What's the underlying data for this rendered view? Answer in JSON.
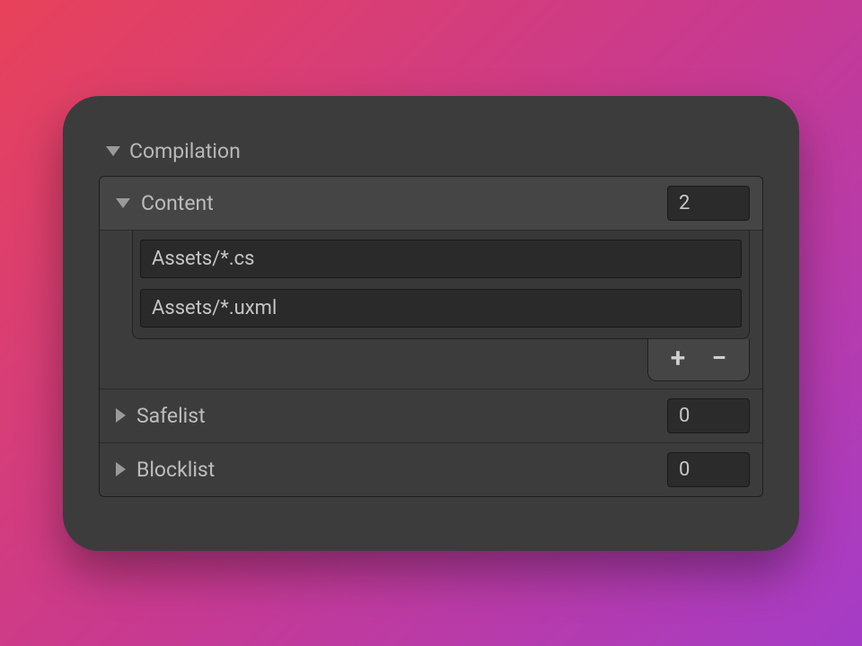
{
  "section": {
    "title": "Compilation"
  },
  "content": {
    "label": "Content",
    "count": "2",
    "items": [
      {
        "value": "Assets/*.cs"
      },
      {
        "value": "Assets/*.uxml"
      }
    ],
    "add_label": "+",
    "remove_label": "−"
  },
  "safelist": {
    "label": "Safelist",
    "count": "0"
  },
  "blocklist": {
    "label": "Blocklist",
    "count": "0"
  }
}
